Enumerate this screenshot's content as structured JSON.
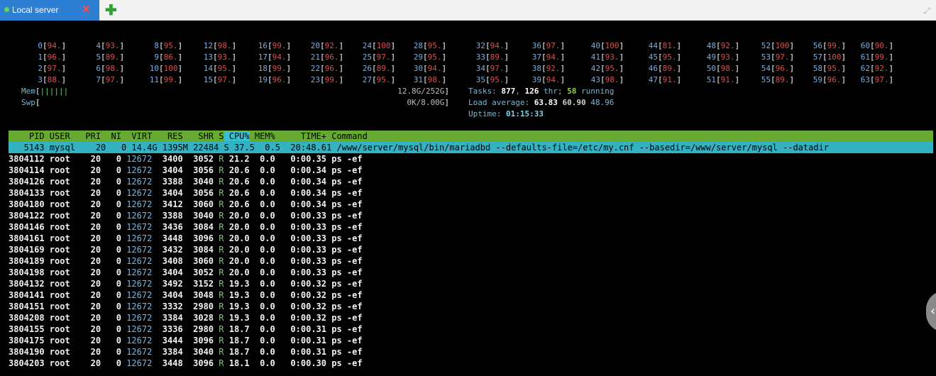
{
  "tab": {
    "title": "Local server",
    "close_icon": "✕",
    "add_icon": "✚",
    "expand_icon": "⤢"
  },
  "cpus": [
    [
      "0",
      "94."
    ],
    [
      "1",
      "96."
    ],
    [
      "2",
      "97."
    ],
    [
      "3",
      "88."
    ],
    [
      "4",
      "93."
    ],
    [
      "5",
      "89."
    ],
    [
      "6",
      "98."
    ],
    [
      "7",
      "97."
    ],
    [
      "8",
      "95."
    ],
    [
      "9",
      "86."
    ],
    [
      "10",
      "100"
    ],
    [
      "11",
      "99."
    ],
    [
      "12",
      "98."
    ],
    [
      "13",
      "93."
    ],
    [
      "14",
      "95."
    ],
    [
      "15",
      "97."
    ],
    [
      "16",
      "99."
    ],
    [
      "17",
      "94."
    ],
    [
      "18",
      "99."
    ],
    [
      "19",
      "96."
    ],
    [
      "20",
      "92."
    ],
    [
      "21",
      "96."
    ],
    [
      "22",
      "96."
    ],
    [
      "23",
      "99."
    ],
    [
      "24",
      "100"
    ],
    [
      "25",
      "97."
    ],
    [
      "26",
      "89."
    ],
    [
      "27",
      "95."
    ],
    [
      "28",
      "95."
    ],
    [
      "29",
      "95."
    ],
    [
      "30",
      "94."
    ],
    [
      "31",
      "98."
    ],
    [
      "32",
      "94."
    ],
    [
      "33",
      "89."
    ],
    [
      "34",
      "97."
    ],
    [
      "35",
      "95."
    ],
    [
      "36",
      "97."
    ],
    [
      "37",
      "94."
    ],
    [
      "38",
      "92."
    ],
    [
      "39",
      "94."
    ],
    [
      "40",
      "100"
    ],
    [
      "41",
      "93."
    ],
    [
      "42",
      "95."
    ],
    [
      "43",
      "98."
    ],
    [
      "44",
      "81."
    ],
    [
      "45",
      "95."
    ],
    [
      "46",
      "89."
    ],
    [
      "47",
      "91."
    ],
    [
      "48",
      "92."
    ],
    [
      "49",
      "93."
    ],
    [
      "50",
      "98."
    ],
    [
      "51",
      "91."
    ],
    [
      "52",
      "100"
    ],
    [
      "53",
      "97."
    ],
    [
      "54",
      "96."
    ],
    [
      "55",
      "89."
    ],
    [
      "56",
      "99."
    ],
    [
      "57",
      "100"
    ],
    [
      "58",
      "95."
    ],
    [
      "59",
      "96."
    ],
    [
      "60",
      "90."
    ],
    [
      "61",
      "99."
    ],
    [
      "62",
      "92."
    ],
    [
      "63",
      "97."
    ]
  ],
  "mem": {
    "label": "Mem",
    "bars": "||||||",
    "value": "12.8G/252G"
  },
  "swp": {
    "label": "Swp",
    "value": "0K/8.00G"
  },
  "tasks": {
    "label": "Tasks:",
    "total": "877",
    "sep": ",",
    "thr": "126",
    "thr_label": "thr;",
    "running": "58",
    "running_label": "running"
  },
  "load": {
    "label": "Load average:",
    "a": "63.83",
    "b": "60.90",
    "c": "48.96"
  },
  "uptime": {
    "label": "Uptime:",
    "value": "01:15:33"
  },
  "columns": [
    "PID",
    "USER",
    "PRI",
    "NI",
    "VIRT",
    "RES",
    "SHR",
    "S",
    "CPU%",
    "MEM%",
    "TIME+",
    "Command"
  ],
  "selected": {
    "pid": "5143",
    "user": "mysql",
    "pri": "20",
    "ni": "0",
    "virt": "14.4G",
    "res": "1395M",
    "shr": "22484",
    "s": "S",
    "cpu": "37.5",
    "mem": "0.5",
    "time": "20:48.61",
    "cmd": "/www/server/mysql/bin/mariadbd --defaults-file=/etc/my.cnf --basedir=/www/server/mysql --datadir"
  },
  "rows": [
    {
      "pid": "3804112",
      "user": "root",
      "pri": "20",
      "ni": "0",
      "virt": "12672",
      "res": "3400",
      "shr": "3052",
      "s": "R",
      "cpu": "21.2",
      "mem": "0.0",
      "time": "0:00.35",
      "cmd": "ps -ef"
    },
    {
      "pid": "3804114",
      "user": "root",
      "pri": "20",
      "ni": "0",
      "virt": "12672",
      "res": "3404",
      "shr": "3056",
      "s": "R",
      "cpu": "20.6",
      "mem": "0.0",
      "time": "0:00.34",
      "cmd": "ps -ef"
    },
    {
      "pid": "3804126",
      "user": "root",
      "pri": "20",
      "ni": "0",
      "virt": "12672",
      "res": "3388",
      "shr": "3040",
      "s": "R",
      "cpu": "20.6",
      "mem": "0.0",
      "time": "0:00.34",
      "cmd": "ps -ef"
    },
    {
      "pid": "3804133",
      "user": "root",
      "pri": "20",
      "ni": "0",
      "virt": "12672",
      "res": "3404",
      "shr": "3056",
      "s": "R",
      "cpu": "20.6",
      "mem": "0.0",
      "time": "0:00.34",
      "cmd": "ps -ef"
    },
    {
      "pid": "3804180",
      "user": "root",
      "pri": "20",
      "ni": "0",
      "virt": "12672",
      "res": "3412",
      "shr": "3060",
      "s": "R",
      "cpu": "20.6",
      "mem": "0.0",
      "time": "0:00.34",
      "cmd": "ps -ef"
    },
    {
      "pid": "3804122",
      "user": "root",
      "pri": "20",
      "ni": "0",
      "virt": "12672",
      "res": "3388",
      "shr": "3040",
      "s": "R",
      "cpu": "20.0",
      "mem": "0.0",
      "time": "0:00.33",
      "cmd": "ps -ef"
    },
    {
      "pid": "3804146",
      "user": "root",
      "pri": "20",
      "ni": "0",
      "virt": "12672",
      "res": "3436",
      "shr": "3084",
      "s": "R",
      "cpu": "20.0",
      "mem": "0.0",
      "time": "0:00.33",
      "cmd": "ps -ef"
    },
    {
      "pid": "3804161",
      "user": "root",
      "pri": "20",
      "ni": "0",
      "virt": "12672",
      "res": "3448",
      "shr": "3096",
      "s": "R",
      "cpu": "20.0",
      "mem": "0.0",
      "time": "0:00.33",
      "cmd": "ps -ef"
    },
    {
      "pid": "3804169",
      "user": "root",
      "pri": "20",
      "ni": "0",
      "virt": "12672",
      "res": "3432",
      "shr": "3084",
      "s": "R",
      "cpu": "20.0",
      "mem": "0.0",
      "time": "0:00.33",
      "cmd": "ps -ef"
    },
    {
      "pid": "3804189",
      "user": "root",
      "pri": "20",
      "ni": "0",
      "virt": "12672",
      "res": "3408",
      "shr": "3060",
      "s": "R",
      "cpu": "20.0",
      "mem": "0.0",
      "time": "0:00.33",
      "cmd": "ps -ef"
    },
    {
      "pid": "3804198",
      "user": "root",
      "pri": "20",
      "ni": "0",
      "virt": "12672",
      "res": "3404",
      "shr": "3052",
      "s": "R",
      "cpu": "20.0",
      "mem": "0.0",
      "time": "0:00.33",
      "cmd": "ps -ef"
    },
    {
      "pid": "3804132",
      "user": "root",
      "pri": "20",
      "ni": "0",
      "virt": "12672",
      "res": "3492",
      "shr": "3152",
      "s": "R",
      "cpu": "19.3",
      "mem": "0.0",
      "time": "0:00.32",
      "cmd": "ps -ef"
    },
    {
      "pid": "3804141",
      "user": "root",
      "pri": "20",
      "ni": "0",
      "virt": "12672",
      "res": "3404",
      "shr": "3048",
      "s": "R",
      "cpu": "19.3",
      "mem": "0.0",
      "time": "0:00.32",
      "cmd": "ps -ef"
    },
    {
      "pid": "3804151",
      "user": "root",
      "pri": "20",
      "ni": "0",
      "virt": "12672",
      "res": "3332",
      "shr": "2980",
      "s": "R",
      "cpu": "19.3",
      "mem": "0.0",
      "time": "0:00.32",
      "cmd": "ps -ef"
    },
    {
      "pid": "3804208",
      "user": "root",
      "pri": "20",
      "ni": "0",
      "virt": "12672",
      "res": "3384",
      "shr": "3028",
      "s": "R",
      "cpu": "19.3",
      "mem": "0.0",
      "time": "0:00.32",
      "cmd": "ps -ef"
    },
    {
      "pid": "3804155",
      "user": "root",
      "pri": "20",
      "ni": "0",
      "virt": "12672",
      "res": "3336",
      "shr": "2980",
      "s": "R",
      "cpu": "18.7",
      "mem": "0.0",
      "time": "0:00.31",
      "cmd": "ps -ef"
    },
    {
      "pid": "3804175",
      "user": "root",
      "pri": "20",
      "ni": "0",
      "virt": "12672",
      "res": "3444",
      "shr": "3096",
      "s": "R",
      "cpu": "18.7",
      "mem": "0.0",
      "time": "0:00.31",
      "cmd": "ps -ef"
    },
    {
      "pid": "3804190",
      "user": "root",
      "pri": "20",
      "ni": "0",
      "virt": "12672",
      "res": "3384",
      "shr": "3040",
      "s": "R",
      "cpu": "18.7",
      "mem": "0.0",
      "time": "0:00.31",
      "cmd": "ps -ef"
    },
    {
      "pid": "3804203",
      "user": "root",
      "pri": "20",
      "ni": "0",
      "virt": "12672",
      "res": "3448",
      "shr": "3096",
      "s": "R",
      "cpu": "18.1",
      "mem": "0.0",
      "time": "0:00.30",
      "cmd": "ps -ef"
    }
  ],
  "side_icon": "‹"
}
